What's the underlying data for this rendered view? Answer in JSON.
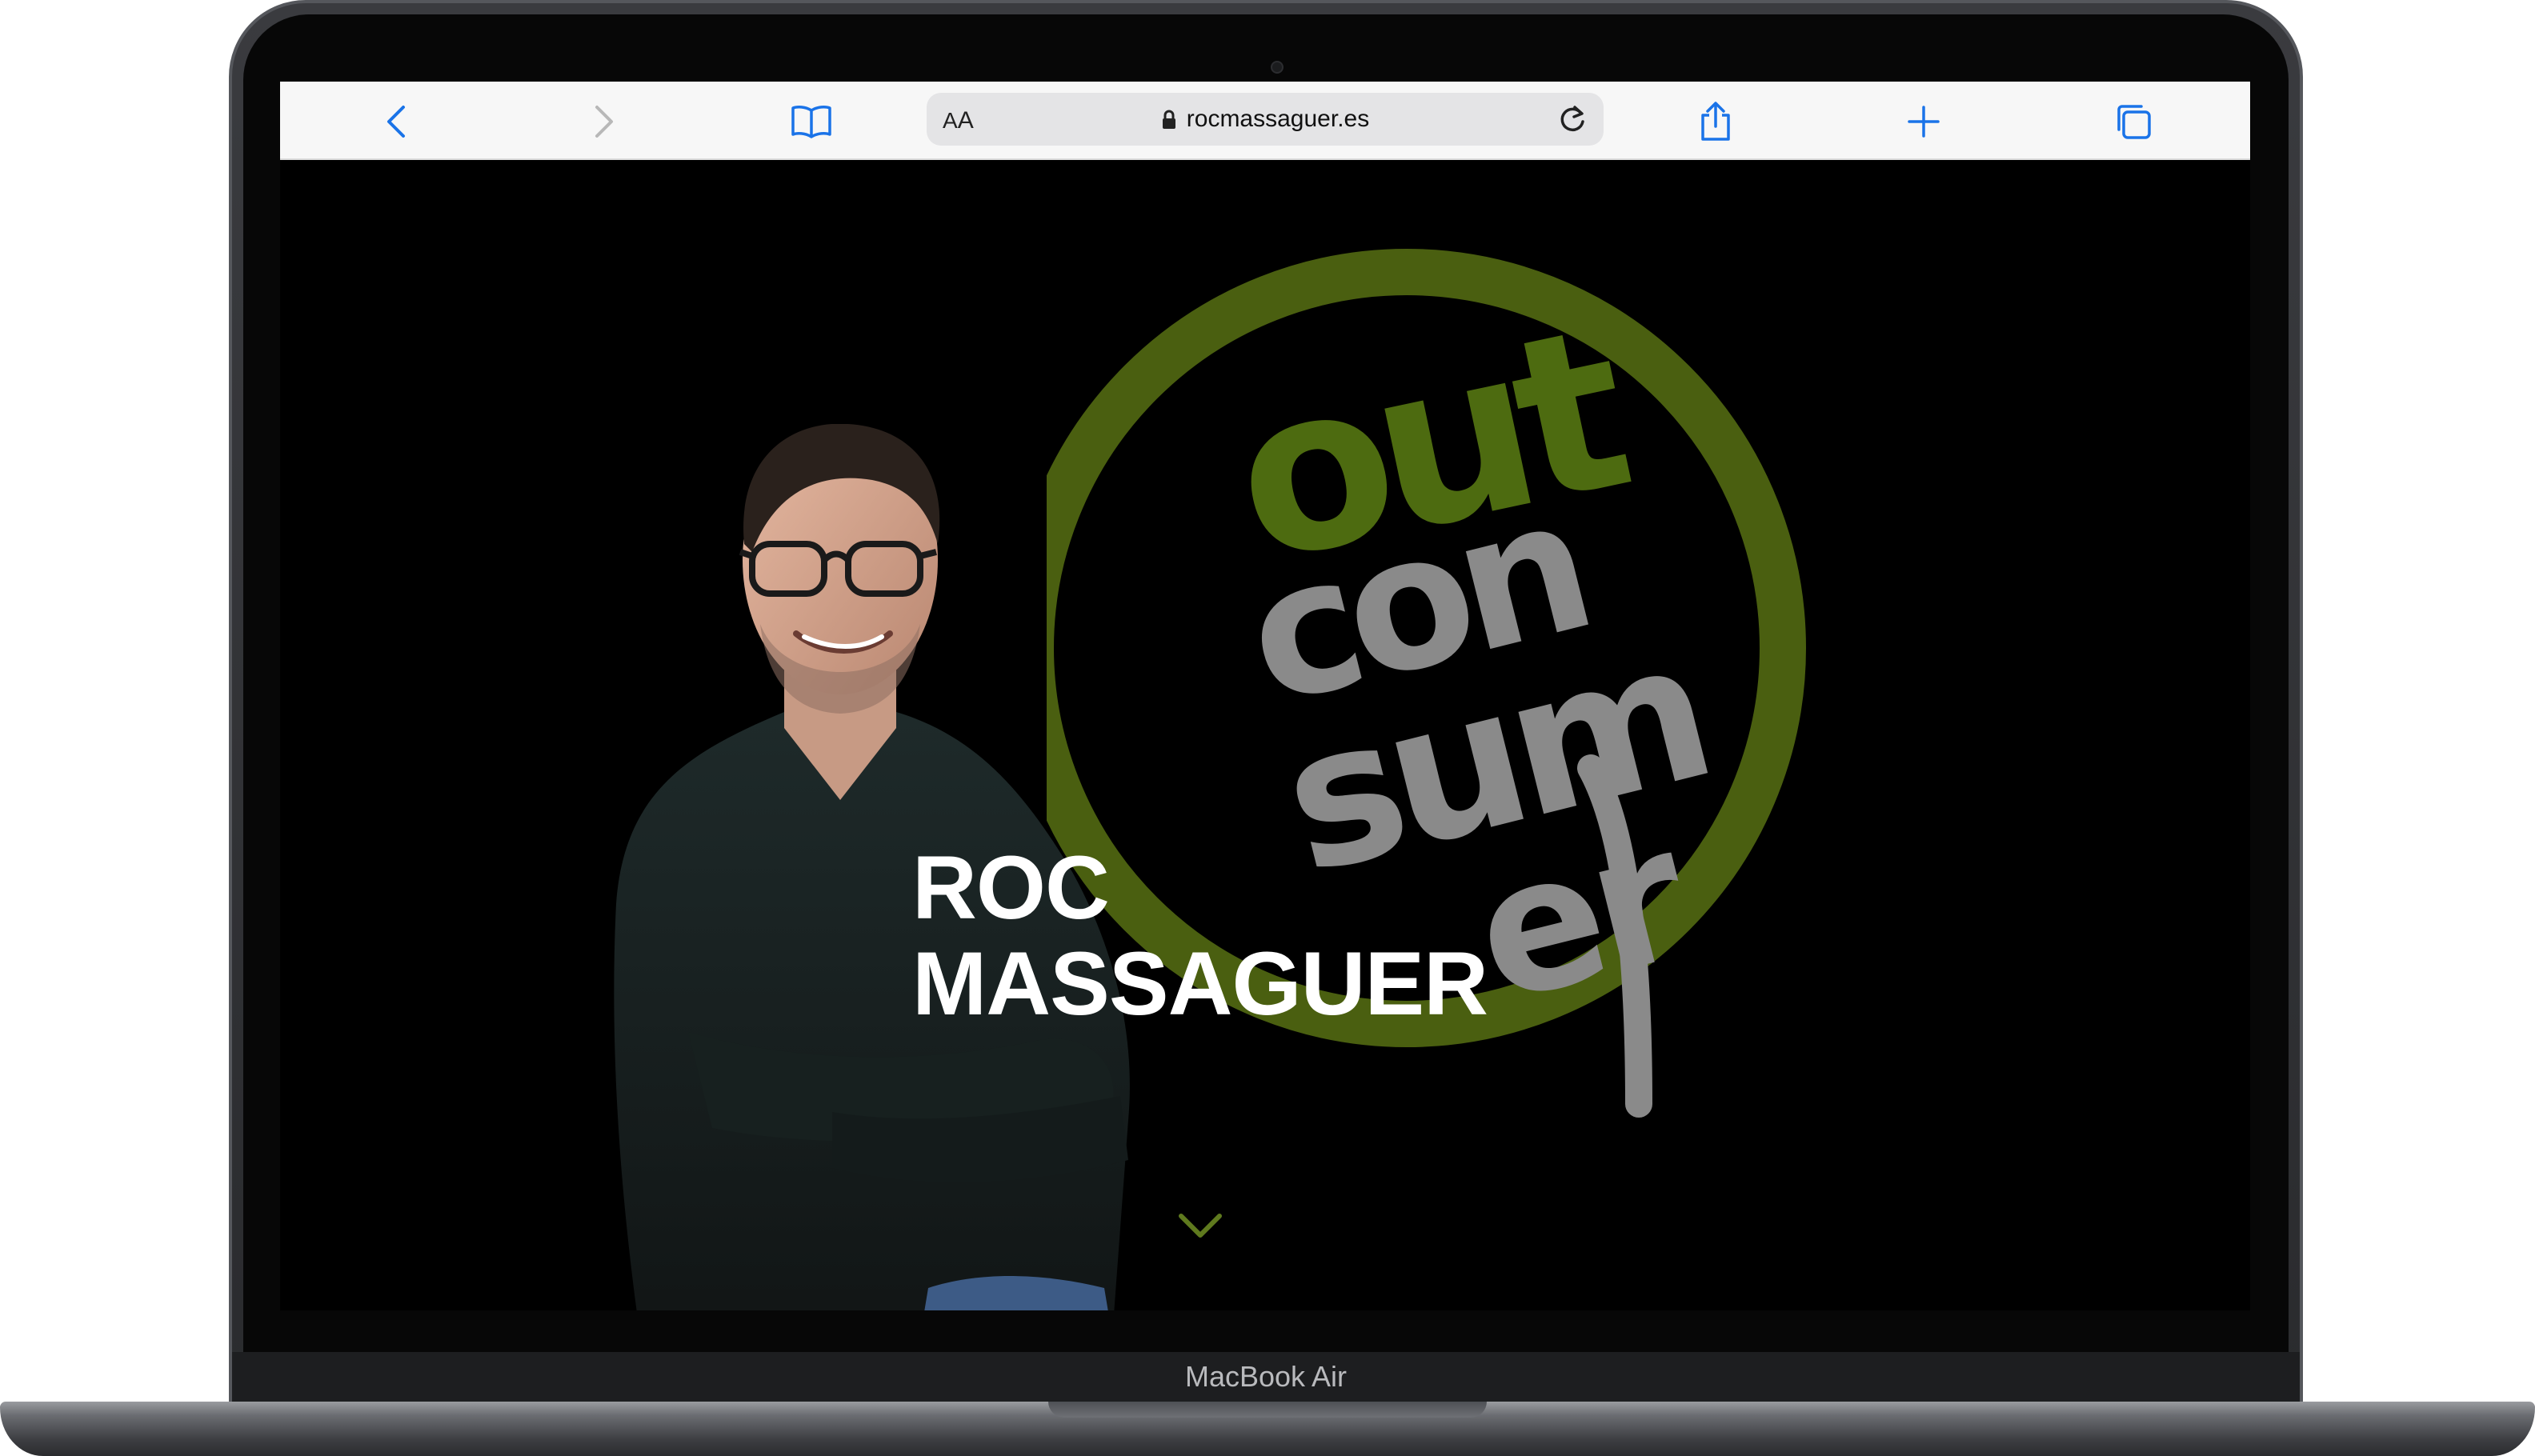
{
  "device": {
    "label": "MacBook Air"
  },
  "browser": {
    "reader_label_small": "A",
    "reader_label_big": "A",
    "url": "rocmassaguer.es"
  },
  "hero": {
    "title_line1": "ROC",
    "title_line2": "MASSAGUER",
    "logo_words": [
      "out",
      "con",
      "sum",
      "er"
    ],
    "colors": {
      "logo_ring": "#4a5f10",
      "logo_out": "#4d6b10",
      "logo_text": "#8a8a8a",
      "accent": "#5f7a1e"
    }
  },
  "icons": [
    "back-icon",
    "forward-icon",
    "bookmarks-icon",
    "lock-icon",
    "reload-icon",
    "share-icon",
    "new-tab-icon",
    "tabs-icon",
    "scroll-down-icon"
  ]
}
